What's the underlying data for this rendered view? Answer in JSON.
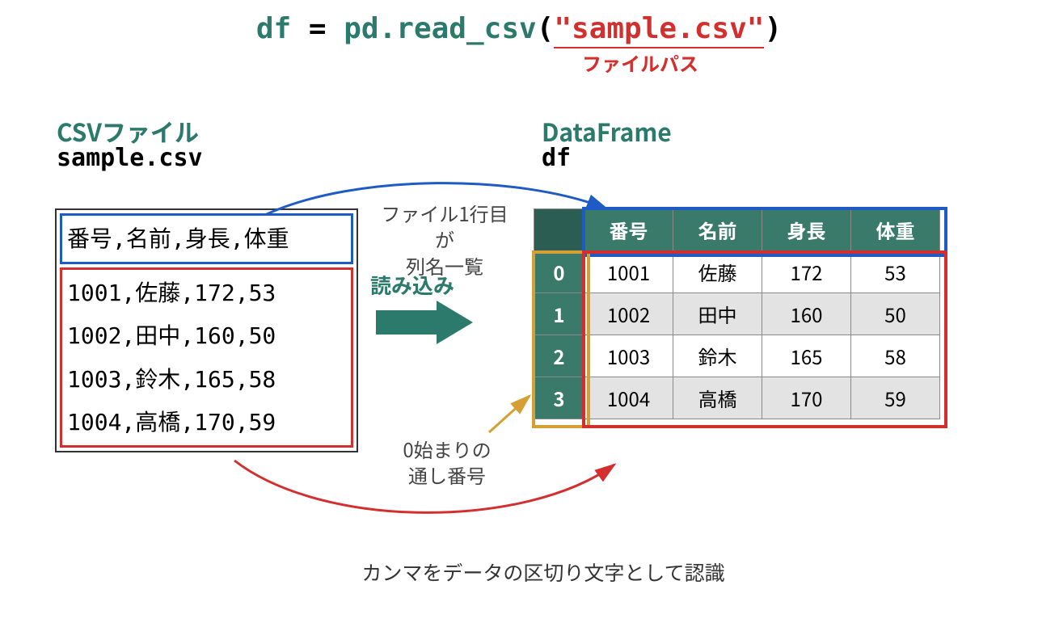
{
  "code": {
    "lhs": "df",
    "eq": " = ",
    "mod": "pd",
    "dot": ".",
    "fn": "read_csv",
    "lp": "(",
    "arg": "\"sample.csv\"",
    "rp": ")"
  },
  "filepath_label": "ファイルパス",
  "labels": {
    "csv_title": "CSVファイル",
    "csv_file": "sample.csv",
    "df_title": "DataFrame",
    "df_var": "df"
  },
  "csv": {
    "header": "番号,名前,身長,体重",
    "rows": [
      "1001,佐藤,172,53",
      "1002,田中,160,50",
      "1003,鈴木,165,58",
      "1004,高橋,170,59"
    ]
  },
  "annotations": {
    "header": "ファイル1行目が\n列名一覧",
    "load": "読み込み",
    "index": "0始まりの\n通し番号",
    "bottom": "カンマをデータの区切り文字として認識"
  },
  "df": {
    "columns": [
      "番号",
      "名前",
      "身長",
      "体重"
    ],
    "index": [
      "0",
      "1",
      "2",
      "3"
    ],
    "data": [
      [
        "1001",
        "佐藤",
        "172",
        "53"
      ],
      [
        "1002",
        "田中",
        "160",
        "50"
      ],
      [
        "1003",
        "鈴木",
        "165",
        "58"
      ],
      [
        "1004",
        "高橋",
        "170",
        "59"
      ]
    ]
  }
}
